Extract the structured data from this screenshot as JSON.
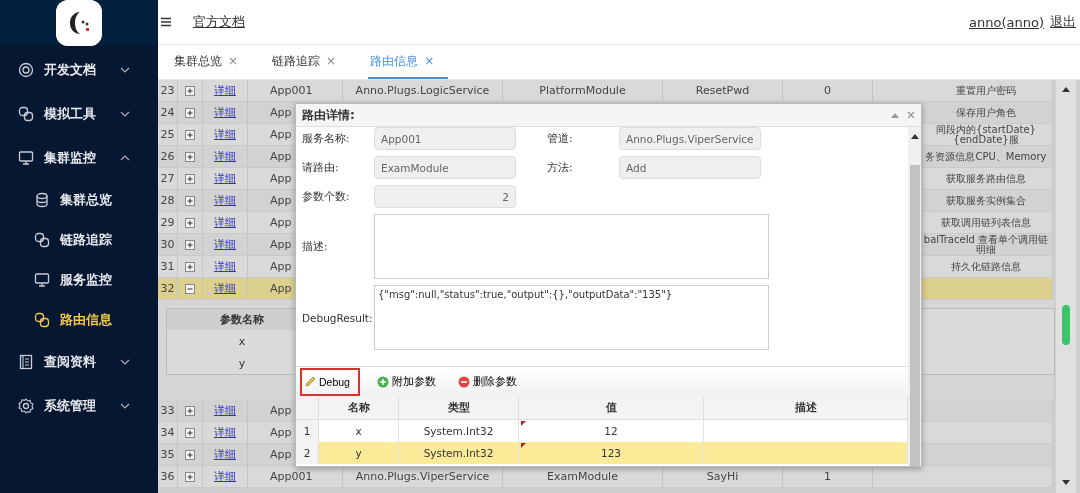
{
  "header": {
    "doc_link": "官方文档",
    "user": "anno(anno)",
    "logout": "退出"
  },
  "sidebar": {
    "items": [
      {
        "label": "开发文档",
        "expanded": false,
        "selected": false
      },
      {
        "label": "模拟工具",
        "expanded": false,
        "selected": false
      },
      {
        "label": "集群监控",
        "expanded": true,
        "selected": false,
        "children": [
          {
            "label": "集群总览",
            "selected": false
          },
          {
            "label": "链路追踪",
            "selected": false
          },
          {
            "label": "服务监控",
            "selected": false
          },
          {
            "label": "路由信息",
            "selected": true
          }
        ]
      },
      {
        "label": "查阅资料",
        "expanded": false,
        "selected": false
      },
      {
        "label": "系统管理",
        "expanded": false,
        "selected": false
      }
    ]
  },
  "tabs": [
    {
      "label": "集群总览",
      "selected": false,
      "close": "×"
    },
    {
      "label": "链路追踪",
      "selected": false,
      "close": "×"
    },
    {
      "label": "路由信息",
      "selected": true,
      "close": "×"
    }
  ],
  "table": {
    "rows": [
      {
        "num": "23",
        "link": "详细",
        "app": "App001",
        "path": "Anno.Plugs.LogicService",
        "module": "PlatformModule",
        "method": "ResetPwd",
        "count": "0",
        "desc": "重置用户密码",
        "expanded": false,
        "selected": false
      },
      {
        "num": "24",
        "link": "详细",
        "app": "App",
        "desc": "保存用户角色",
        "expanded": false,
        "selected": false
      },
      {
        "num": "25",
        "link": "详细",
        "app": "App",
        "desc": "间段内的{startDate} {endDate}服",
        "expanded": false,
        "selected": false
      },
      {
        "num": "26",
        "link": "详细",
        "app": "App",
        "desc": "务资源信息CPU、Memory",
        "expanded": false,
        "selected": false
      },
      {
        "num": "27",
        "link": "详细",
        "app": "App",
        "desc": "获取服务路由信息",
        "expanded": false,
        "selected": false
      },
      {
        "num": "28",
        "link": "详细",
        "app": "App",
        "desc": "获取服务实例集合",
        "expanded": false,
        "selected": false
      },
      {
        "num": "29",
        "link": "详细",
        "app": "App",
        "desc": "获取调用链列表信息",
        "expanded": false,
        "selected": false
      },
      {
        "num": "30",
        "link": "详细",
        "app": "App",
        "desc": "balTraceId 查看单个调用链明细",
        "expanded": false,
        "selected": false
      },
      {
        "num": "31",
        "link": "详细",
        "app": "App",
        "desc": "持久化链路信息",
        "expanded": false,
        "selected": false
      },
      {
        "num": "32",
        "link": "详细",
        "app": "App",
        "expanded": true,
        "selected": true,
        "detail": {
          "column": "参数名称",
          "rows": [
            "x",
            "y"
          ]
        }
      },
      {
        "num": "33",
        "link": "详细",
        "app": "App",
        "expanded": false,
        "selected": false
      },
      {
        "num": "34",
        "link": "详细",
        "app": "App",
        "expanded": false,
        "selected": false
      },
      {
        "num": "35",
        "link": "详细",
        "app": "App",
        "expanded": false,
        "selected": false
      },
      {
        "num": "36",
        "link": "详细",
        "app": "App001",
        "path": "Anno.Plugs.ViperService",
        "module": "ExamModule",
        "method": "SayHi",
        "count": "1",
        "expanded": false,
        "selected": false
      }
    ]
  },
  "dialog": {
    "title": "路由详情:",
    "fields": [
      {
        "kind": "input",
        "label": "服务名称:",
        "value": "App001"
      },
      {
        "kind": "input",
        "label": "管道:",
        "value": "Anno.Plugs.ViperService"
      },
      {
        "kind": "input",
        "label": "请路由:",
        "value": "ExamModule"
      },
      {
        "kind": "input",
        "label": "方法:",
        "value": "Add"
      },
      {
        "kind": "number",
        "label": "参数个数:",
        "value": "2"
      },
      {
        "kind": "textarea",
        "label": "描述:"
      },
      {
        "kind": "textarea",
        "label": "DebugResult:",
        "value": "{\"msg\":null,\"status\":true,\"output\":{},\"outputData\":\"135\"}"
      }
    ],
    "toolbar": [
      {
        "kind": "debug",
        "label": "Debug",
        "highlighted": true
      },
      {
        "kind": "add",
        "label": "附加参数",
        "highlighted": false
      },
      {
        "kind": "remove",
        "label": "删除参数",
        "highlighted": false
      }
    ],
    "grid": {
      "columns": [
        "名称",
        "类型",
        "值",
        "描述"
      ],
      "rows": [
        {
          "num": "1",
          "name": "x",
          "type": "System.Int32",
          "value": "12",
          "edited": true,
          "selected": false
        },
        {
          "num": "2",
          "name": "y",
          "type": "System.Int32",
          "value": "123",
          "edited": true,
          "selected": true
        }
      ]
    }
  }
}
